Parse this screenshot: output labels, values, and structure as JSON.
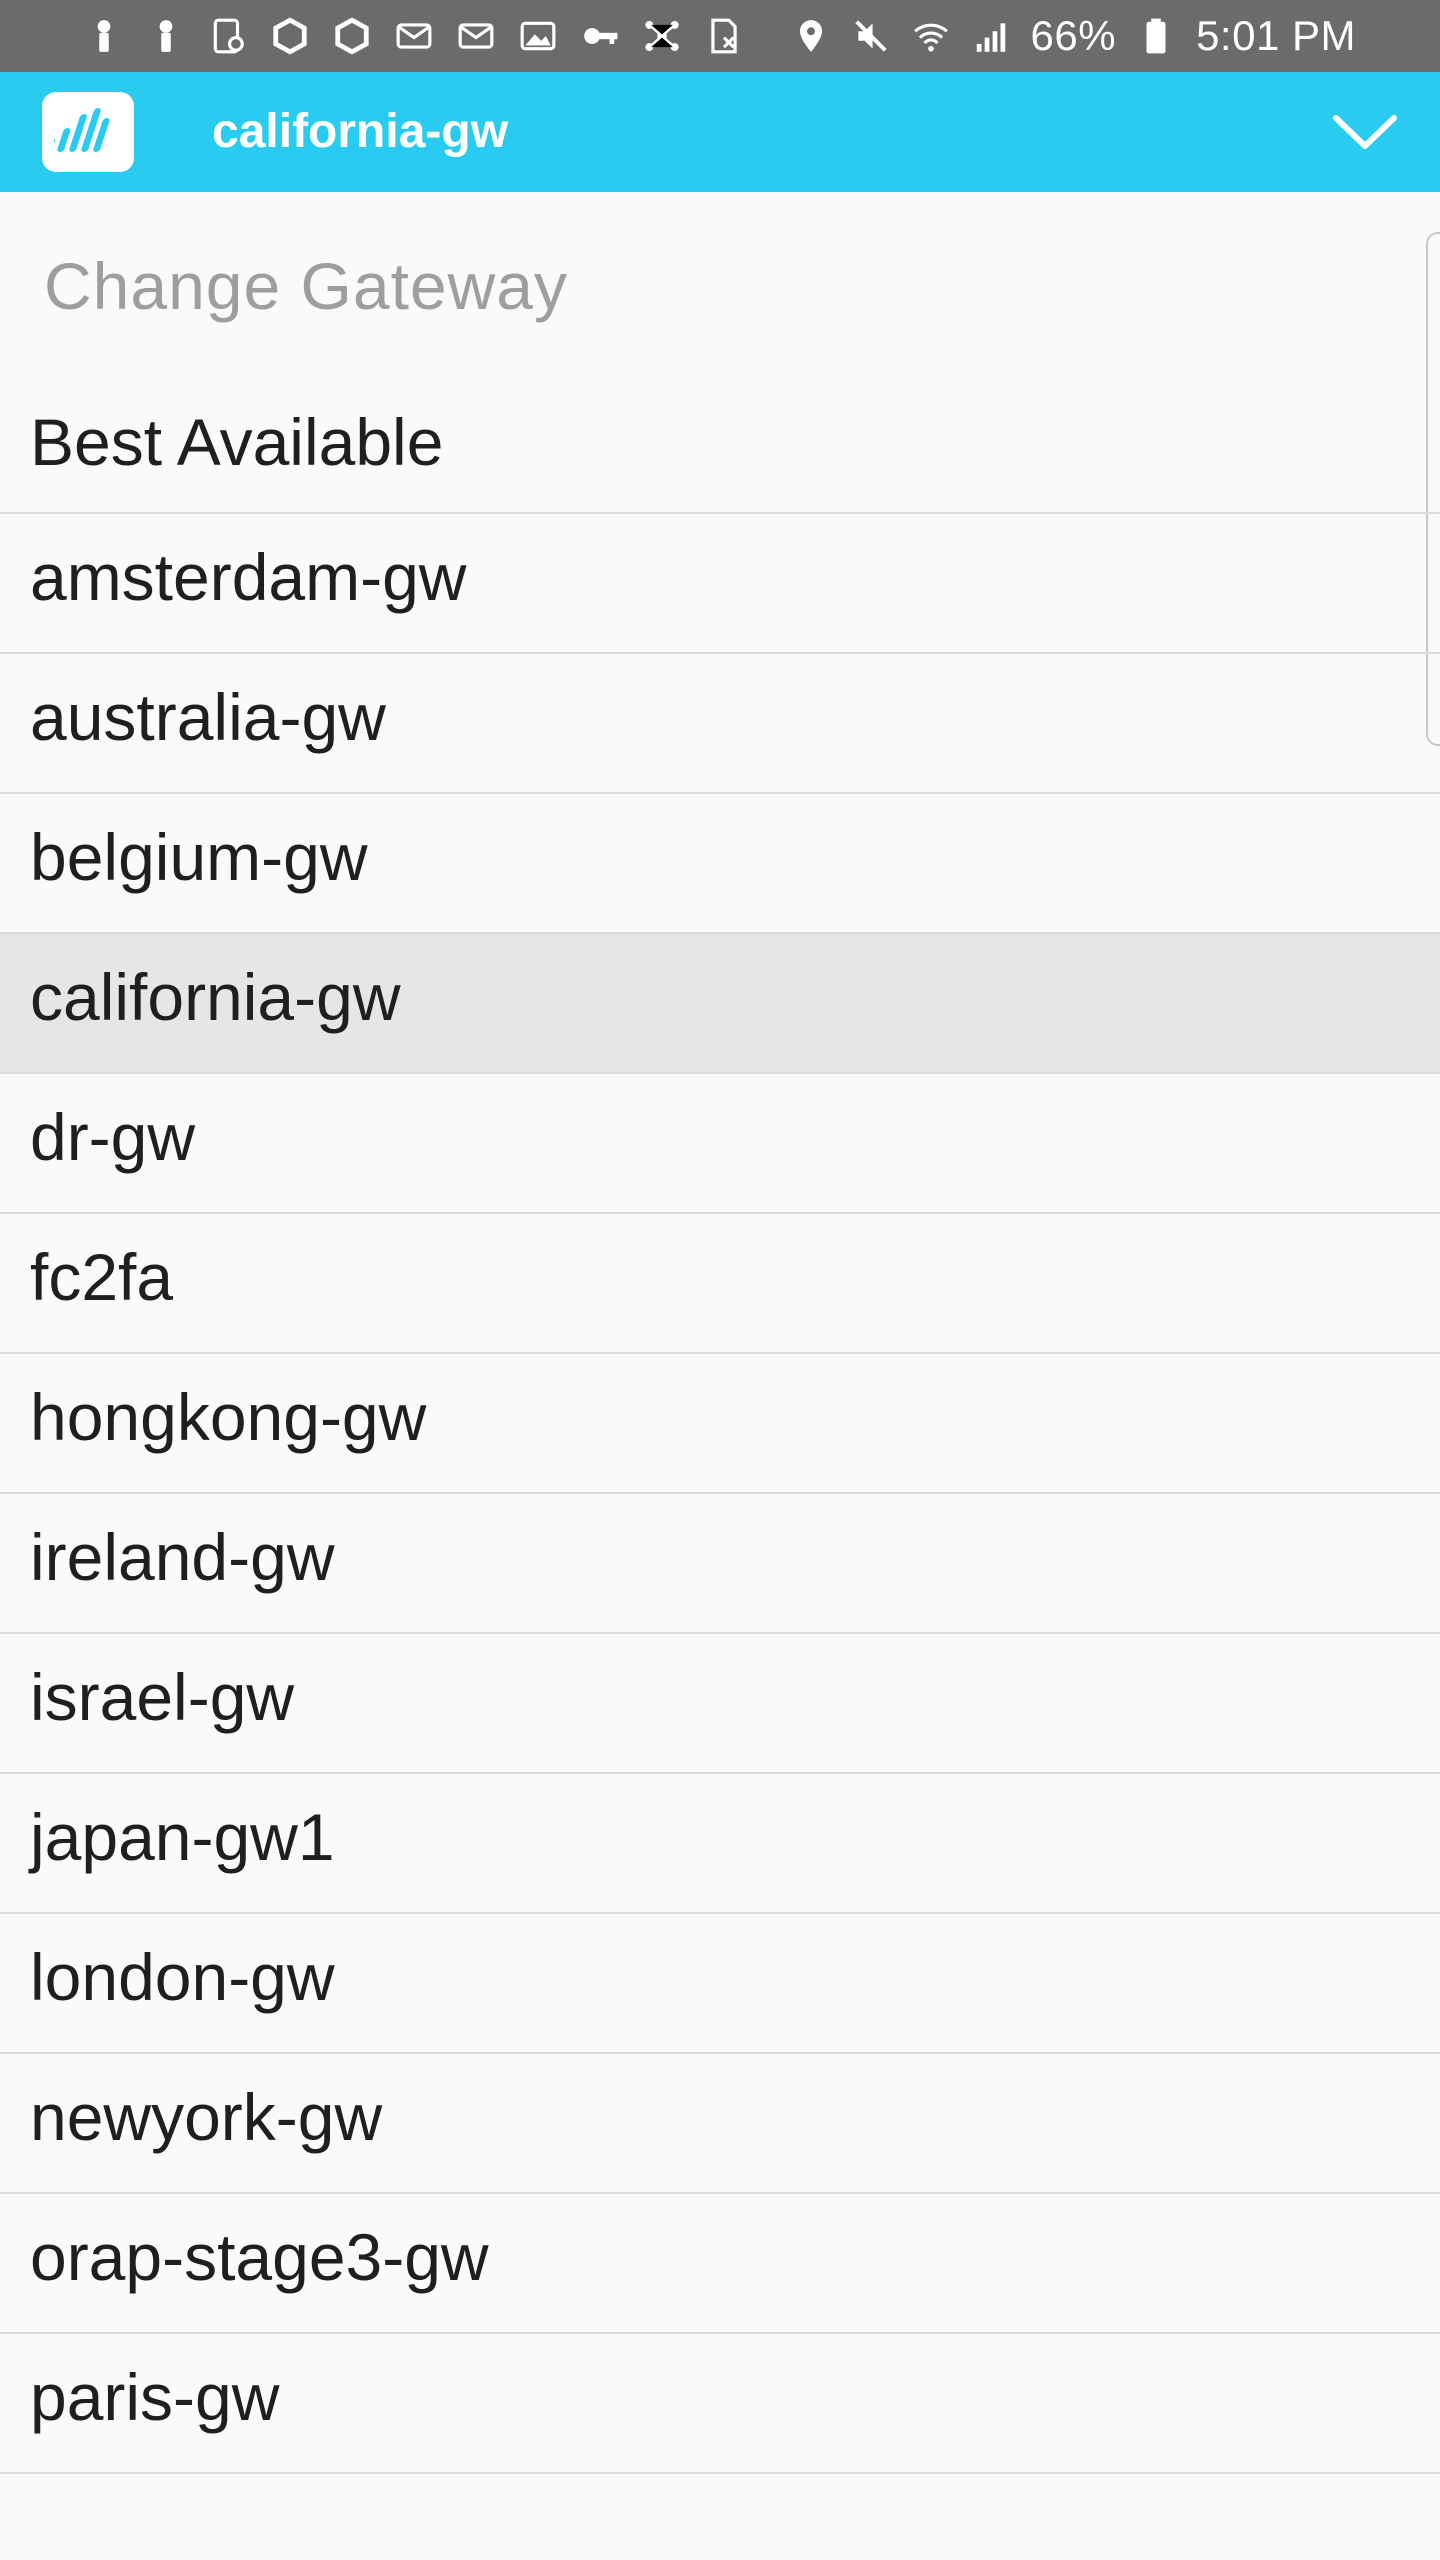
{
  "status_bar": {
    "left_icons": [
      "person-pin-icon",
      "person-pin-icon",
      "screen-record-icon",
      "hexagon-app-icon",
      "hexagon-app-icon",
      "mail-icon",
      "mail-icon",
      "image-icon",
      "key-icon",
      "network-icon",
      "sim-off-icon"
    ],
    "right_icons": [
      "location-icon",
      "mute-icon",
      "wifi-icon",
      "signal-icon"
    ],
    "battery": "66%",
    "time": "5:01 PM"
  },
  "app_bar": {
    "title": "california-gw",
    "accent_color": "#29ccf0",
    "dropdown_icon": "chevron-down-icon",
    "logo_icon": "app-logo-icon"
  },
  "gateway_menu": {
    "header": "Change Gateway",
    "selected": "california-gw",
    "items": [
      {
        "label": "Best Available"
      },
      {
        "label": "amsterdam-gw"
      },
      {
        "label": "australia-gw"
      },
      {
        "label": "belgium-gw"
      },
      {
        "label": "california-gw"
      },
      {
        "label": "dr-gw"
      },
      {
        "label": "fc2fa"
      },
      {
        "label": "hongkong-gw"
      },
      {
        "label": "ireland-gw"
      },
      {
        "label": "israel-gw"
      },
      {
        "label": "japan-gw1"
      },
      {
        "label": "london-gw"
      },
      {
        "label": "newyork-gw"
      },
      {
        "label": "orap-stage3-gw"
      },
      {
        "label": "paris-gw"
      }
    ]
  }
}
